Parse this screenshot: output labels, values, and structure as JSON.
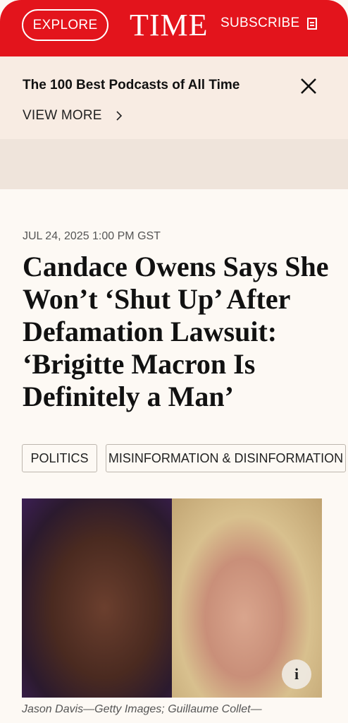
{
  "header": {
    "explore_label": "EXPLORE",
    "logo_text": "TIME",
    "subscribe_label": "SUBSCRIBE",
    "brand_color": "#e3141c",
    "subscribe_icon": "newspaper-icon"
  },
  "promo": {
    "title": "The 100 Best Podcasts of All Time",
    "view_more_label": "VIEW MORE",
    "close_icon": "close-icon",
    "chevron_icon": "chevron-right-icon"
  },
  "article": {
    "dateline": "JUL 24, 2025 1:00 PM GST",
    "headline": "Candace Owens Says She Won’t ‘Shut Up’ After Defamation Lawsuit: ‘Brigitte Macron Is Definitely a Man’",
    "tags": [
      "POLITICS",
      "MISINFORMATION & DISINFORMATION"
    ],
    "photo_info_label": "i",
    "photo_credit": "Jason Davis—Getty Images; Guillaume Collet—"
  }
}
